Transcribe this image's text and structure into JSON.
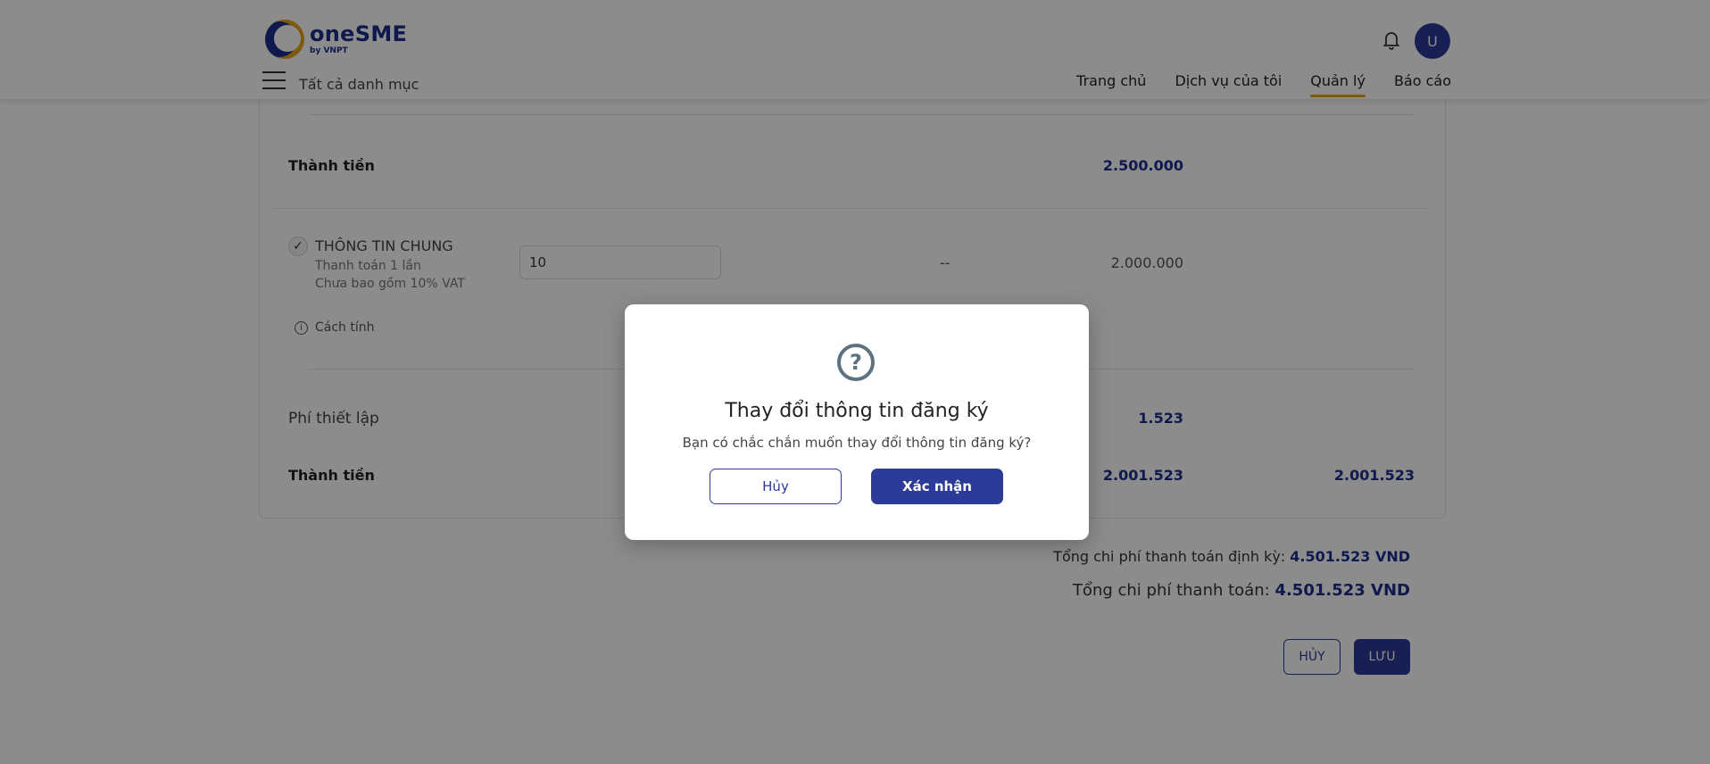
{
  "header": {
    "logo_name": "oneSME",
    "logo_sub": "by VNPT",
    "all_categories": "Tất cả danh mục",
    "avatar_letter": "U",
    "nav": [
      "Trang chủ",
      "Dịch vụ của tôi",
      "Quản lý",
      "Báo cáo"
    ],
    "active_nav": "Quản lý"
  },
  "summary_top": {
    "label": "Thành tiền",
    "value": "2.500.000"
  },
  "item": {
    "name": "THÔNG TIN CHUNG",
    "payment": "Thanh toán 1 lần",
    "vat_note": "Chưa bao gồm 10% VAT",
    "quantity": "10",
    "discount": "--",
    "price": "2.000.000",
    "calc_link": "Cách tính"
  },
  "setup_fee": {
    "label": "Phí thiết lập",
    "value": "1.523"
  },
  "summary_bottom": {
    "label": "Thành tiền",
    "value": "2.001.523",
    "total": "2.001.523"
  },
  "totals": {
    "periodic_label": "Tổng chi phí thanh toán định kỳ:",
    "periodic_value": "4.501.523 VND",
    "total_label": "Tổng chi phí thanh toán:",
    "total_value": "4.501.523 VND"
  },
  "actions": {
    "cancel": "HỦY",
    "save": "LƯU"
  },
  "modal": {
    "icon": "question-circle-icon",
    "title": "Thay đổi thông tin đăng ký",
    "message": "Bạn có chắc chắn muốn thay đổi thông tin đăng ký?",
    "cancel": "Hủy",
    "confirm": "Xác nhận"
  },
  "colors": {
    "brand": "#2c3b97",
    "accent": "#e8a317"
  }
}
